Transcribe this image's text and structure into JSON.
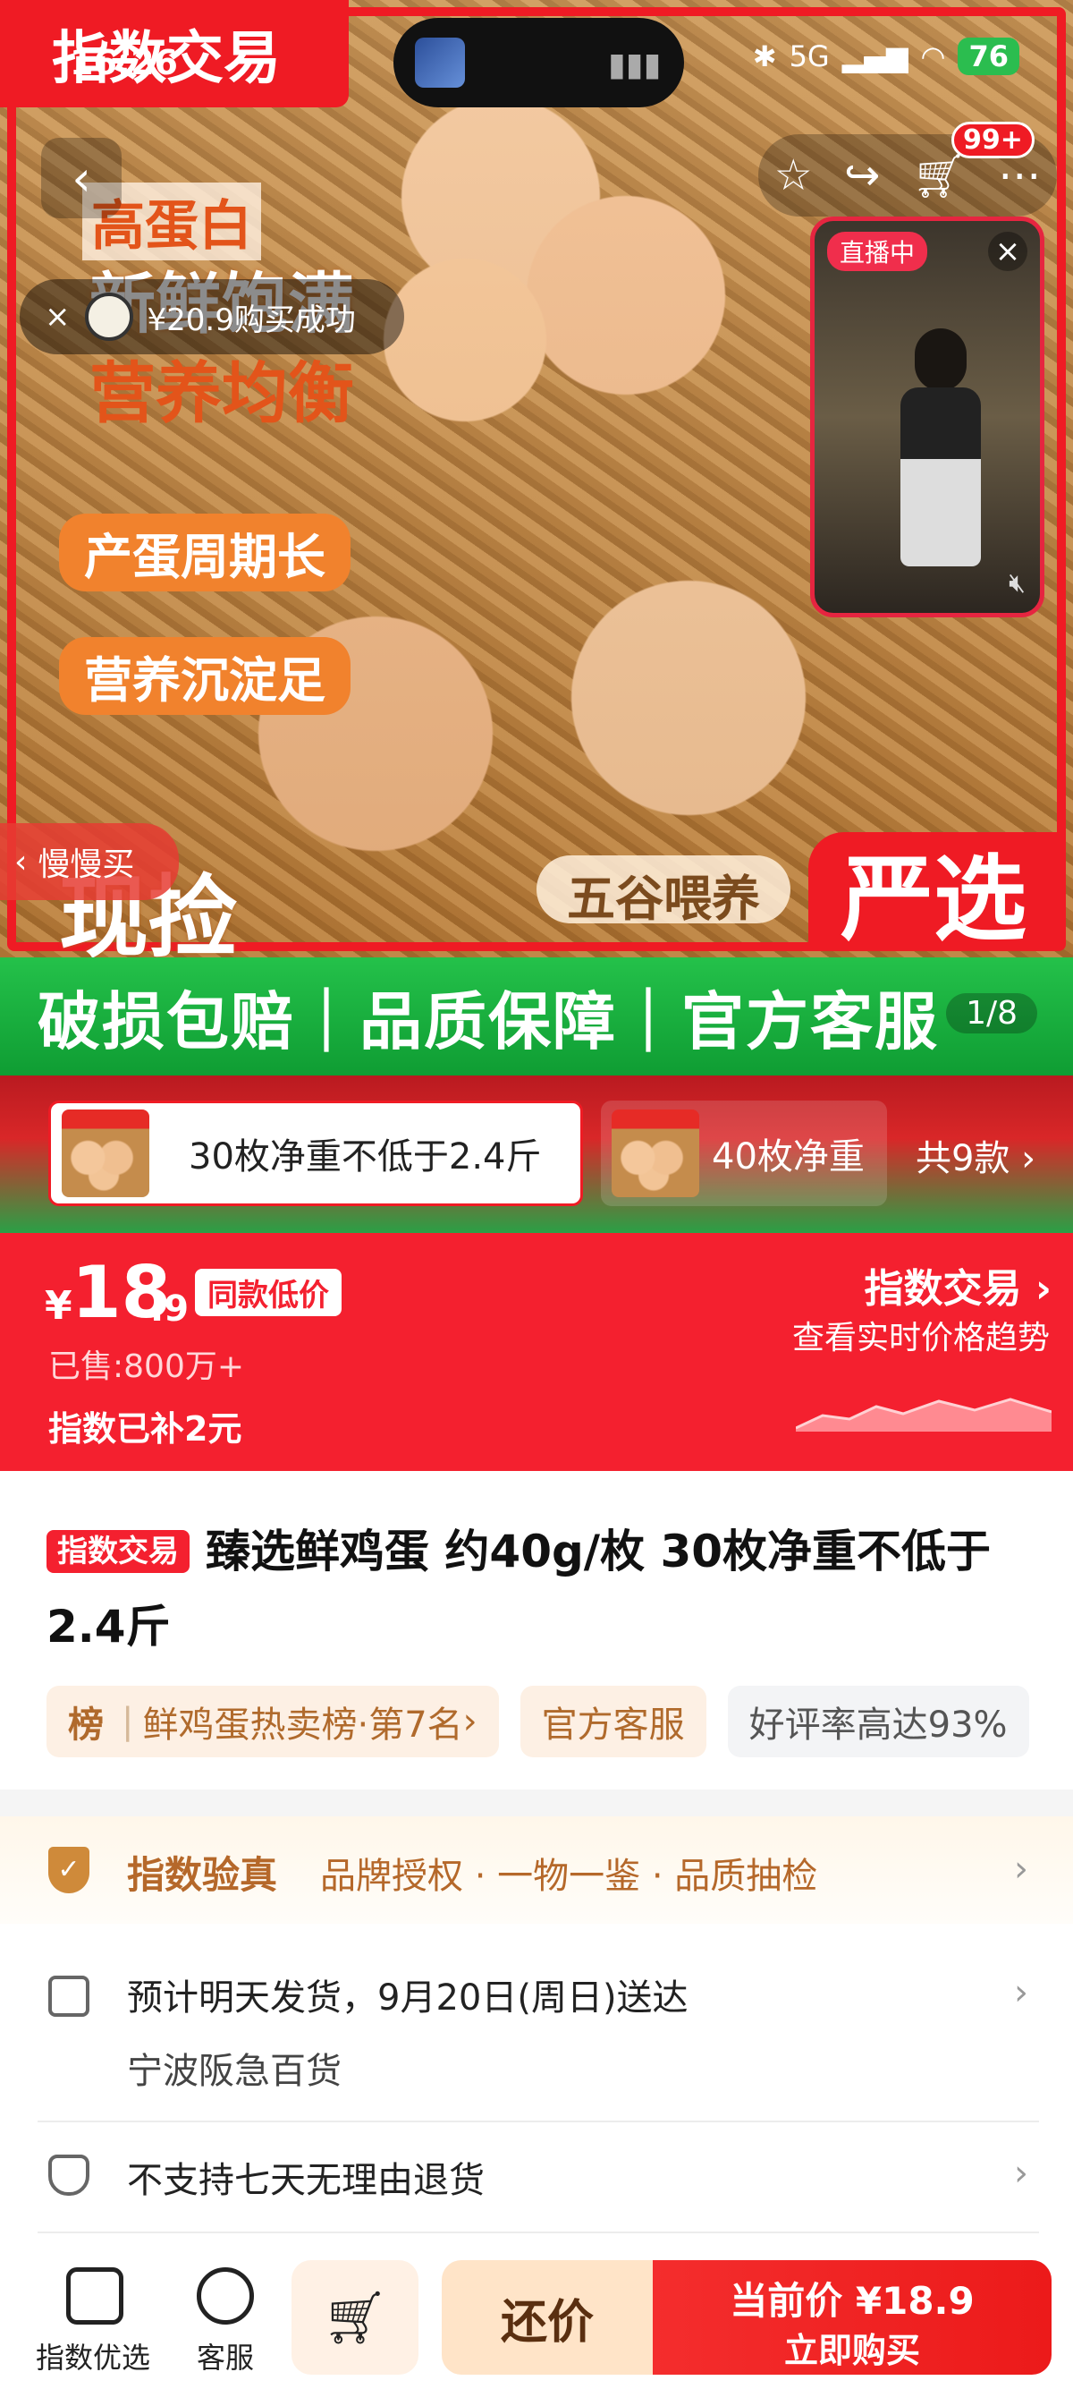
{
  "status_bar": {
    "time": "16:26",
    "network": "5G",
    "battery": "76"
  },
  "hero": {
    "brand_tag": "指数交易",
    "promo_lines": [
      "高蛋白",
      "新鲜饱满",
      "营养均衡"
    ],
    "pills": [
      "产蛋周期长",
      "营养沉淀足"
    ],
    "bottom_left_text": "现捡",
    "bottom_mid_text": "五谷喂养",
    "bottom_right_text": "严选",
    "cart_badge": "99+",
    "toast": "¥20.9购买成功",
    "slow_buy": "慢慢买",
    "live_tag": "直播中"
  },
  "banner": {
    "text": "破损包赔｜品质保障｜官方客服",
    "counter": "1/8"
  },
  "variants": {
    "items": [
      {
        "label": "30枚净重不低于2.4斤",
        "selected": true
      },
      {
        "label": "40枚净重",
        "selected": false
      }
    ],
    "total": "共9款"
  },
  "price": {
    "currency": "¥",
    "integer": "18",
    "decimal": ".9",
    "low_badge": "同款低价",
    "sold": "已售:800万+",
    "subsidy": "指数已补2元",
    "index_title": "指数交易",
    "index_sub": "查看实时价格趋势"
  },
  "product": {
    "badge": "指数交易",
    "title": "臻选鲜鸡蛋 约40g/枚 30枚净重不低于2.4斤",
    "chips": {
      "rank_label": "榜",
      "rank_text": "鲜鸡蛋热卖榜·第7名",
      "service": "官方客服",
      "rating": "好评率高达93%"
    }
  },
  "service": {
    "verify_title": "指数验真",
    "verify_items": "品牌授权 · 一物一鉴 · 品质抽检",
    "delivery": "预计明天发货，9月20日(周日)送达",
    "store": "宁波阪急百货",
    "returns": "不支持七天无理由退货"
  },
  "bottom_bar": {
    "shop_label": "指数优选",
    "service_label": "客服",
    "haggle": "还价",
    "buy_price": "当前价 ¥18.9",
    "buy_label": "立即购买"
  },
  "colors": {
    "brand_red": "#ef1b24",
    "green": "#1aa93c",
    "gold": "#b5682a"
  },
  "icons": [
    "back-icon",
    "star-icon",
    "share-icon",
    "cart-icon",
    "more-icon",
    "close-icon",
    "mute-icon",
    "shield-check-icon",
    "truck-icon",
    "return-icon",
    "shop-icon",
    "smile-icon",
    "cart-add-icon",
    "chevron-right-icon"
  ]
}
